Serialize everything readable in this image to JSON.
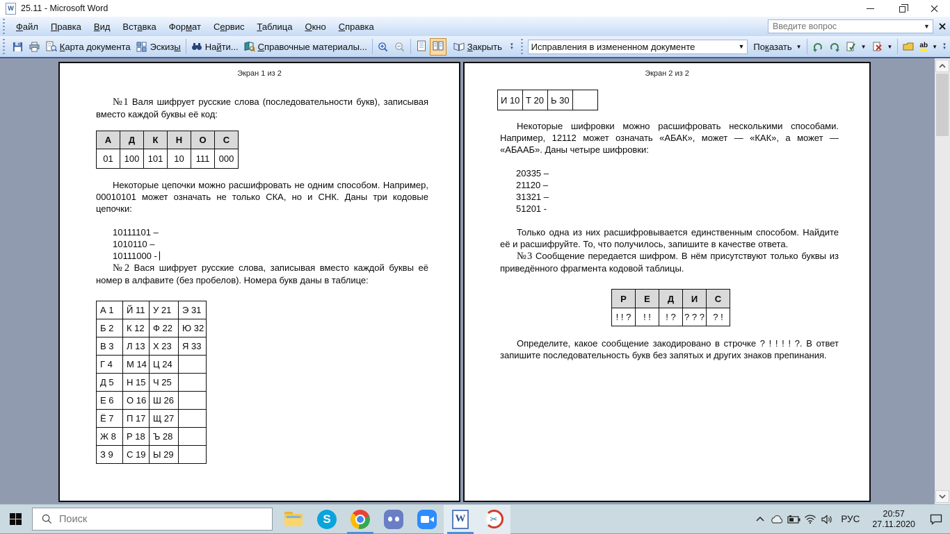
{
  "window": {
    "title": "25.11 - Microsoft Word",
    "question_placeholder": "Введите вопрос"
  },
  "menu": {
    "items": [
      {
        "pre": "",
        "key": "Ф",
        "post": "айл"
      },
      {
        "pre": "",
        "key": "П",
        "post": "равка"
      },
      {
        "pre": "",
        "key": "В",
        "post": "ид"
      },
      {
        "pre": "Вст",
        "key": "а",
        "post": "вка"
      },
      {
        "pre": "Фор",
        "key": "м",
        "post": "ат"
      },
      {
        "pre": "С",
        "key": "е",
        "post": "рвис"
      },
      {
        "pre": "",
        "key": "Т",
        "post": "аблица"
      },
      {
        "pre": "",
        "key": "О",
        "post": "кно"
      },
      {
        "pre": "",
        "key": "С",
        "post": "правка"
      }
    ]
  },
  "toolbar": {
    "doc_map": {
      "pre": "",
      "key": "К",
      "post": "арта документа"
    },
    "thumbnails": {
      "pre": "Эскиз",
      "key": "ы",
      "post": ""
    },
    "find": {
      "pre": "На",
      "key": "й",
      "post": "ти..."
    },
    "research": {
      "pre": "",
      "key": "С",
      "post": "правочные материалы..."
    },
    "close": {
      "pre": "",
      "key": "З",
      "post": "акрыть"
    },
    "review_mode": "Исправления в измененном документе",
    "show": {
      "pre": "По",
      "key": "к",
      "post": "азать"
    }
  },
  "doc": {
    "page1": {
      "header": "Экран 1 из 2",
      "p1_marker": "№1",
      "p1": "Валя шифрует русские слова (последовательности букв), записывая вместо каждой буквы её код:",
      "table1": {
        "header": [
          "А",
          "Д",
          "К",
          "Н",
          "О",
          "С"
        ],
        "codes": [
          "01",
          "100",
          "101",
          "10",
          "111",
          "000"
        ]
      },
      "p2": "Некоторые цепочки можно расшифровать не одним способом. Например, 00010101 может означать не только СКА, но и СНК. Даны три кодовые цепочки:",
      "chains": [
        "10111101 –",
        "1010110 –",
        "10111000 -"
      ],
      "p3_marker": "№2",
      "p3": "Вася шифрует русские слова, записывая вместо каждой буквы её номер в алфавите (без пробелов). Номера букв даны в таблице:",
      "table2": {
        "rows": [
          [
            "А 1",
            "Й 11",
            "У 21",
            "Э 31"
          ],
          [
            "Б 2",
            "К 12",
            "Ф 22",
            "Ю 32"
          ],
          [
            "В 3",
            "Л 13",
            "Х 23",
            "Я 33"
          ],
          [
            "Г 4",
            "М 14",
            "Ц 24",
            ""
          ],
          [
            "Д 5",
            "Н 15",
            "Ч 25",
            ""
          ],
          [
            "Е 6",
            "О 16",
            "Ш 26",
            ""
          ],
          [
            "Ё 7",
            "П 17",
            "Щ 27",
            ""
          ],
          [
            "Ж 8",
            "Р 18",
            "Ъ 28",
            ""
          ],
          [
            "З 9",
            "С 19",
            "Ы 29",
            ""
          ]
        ]
      }
    },
    "page2": {
      "header": "Экран 2 из 2",
      "table1": {
        "cells": [
          "И 10",
          "Т 20",
          "Ь 30",
          ""
        ]
      },
      "p1": "Некоторые шифровки можно расшифровать несколькими способами. Например, 12112 может означать «АБАК», может — «КАК», а может — «АБААБ». Даны четыре шифровки:",
      "chains": [
        "20335 –",
        "21120 –",
        "31321 –",
        "51201 -"
      ],
      "p2": "Только одна из них расшифровывается единственным способом. Найдите её и расшифруйте. То, что получилось, запишите в качестве ответа.",
      "p3_marker": "№3",
      "p3": "Сообщение передается шифром. В нём присутствуют только буквы из приведённого фрагмента кодовой таблицы.",
      "table2": {
        "header": [
          "Р",
          "Е",
          "Д",
          "И",
          "С"
        ],
        "values": [
          "! ! ?",
          "! !",
          "! ?",
          "? ? ?",
          "? !"
        ]
      },
      "p4": "Определите, какое сообщение закодировано в строчке ? ! ! ! ! ?. В ответ запишите последовательность букв без запятых и других знаков препинания."
    }
  },
  "taskbar": {
    "search_placeholder": "Поиск",
    "language": "РУС",
    "time": "20:57",
    "date": "27.11.2020"
  }
}
